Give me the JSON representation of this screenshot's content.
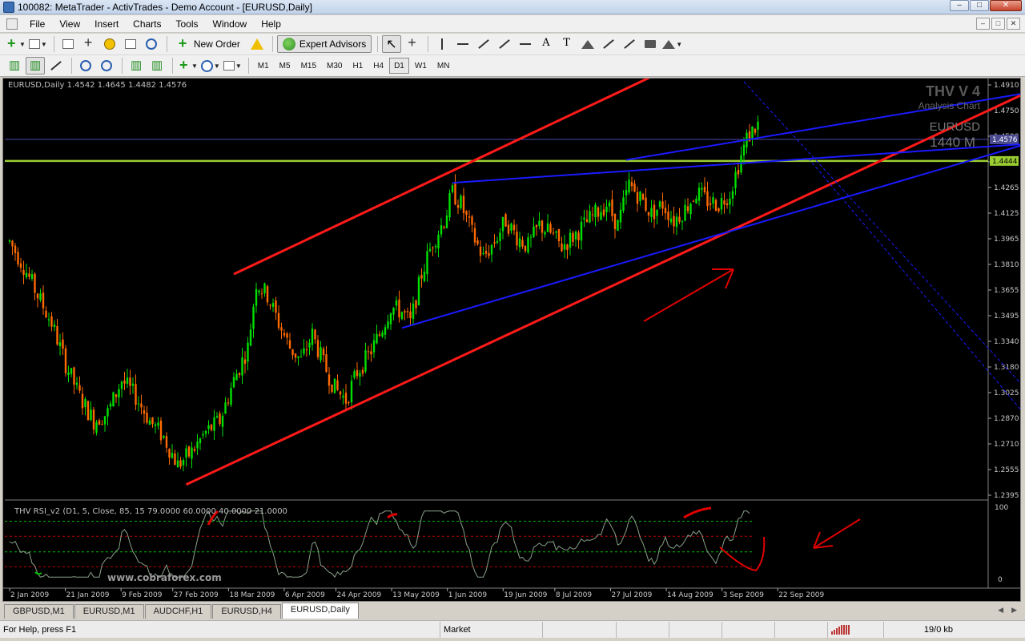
{
  "window": {
    "title": "100082: MetaTrader - ActivTrades - Demo Account - [EURUSD,Daily]",
    "controls": [
      "–",
      "□",
      "✕"
    ]
  },
  "menu": {
    "items": [
      "File",
      "View",
      "Insert",
      "Charts",
      "Tools",
      "Window",
      "Help"
    ]
  },
  "toolbar": {
    "new_order": "New Order",
    "expert_advisors": "Expert Advisors",
    "timeframes": [
      "M1",
      "M5",
      "M15",
      "M30",
      "H1",
      "H4",
      "D1",
      "W1",
      "MN"
    ],
    "active_timeframe": "D1"
  },
  "chart": {
    "header": "EURUSD,Daily  1.4542 1.4645 1.4482 1.4576",
    "indicator_header": "THV RSI_v2  (D1,  5,  Close,  85,  15 79.0000 60.0000 40.0000 21.0000",
    "overlay_title": "THV V 4",
    "overlay_subtitle": "Analysis Chart",
    "overlay_symbol": "EURUSD",
    "overlay_timeframe": "1440 M",
    "watermark": "www.cobraforex.com",
    "current_price_label": "1.4576",
    "level_price_label": "1.4444",
    "indicator_top_label": "100",
    "indicator_bottom_label": "0",
    "colors": {
      "background": "#000000",
      "bull_candle": "#00e000",
      "bear_candle": "#ff6a00",
      "channel": "#ff1a1a",
      "trendline": "#1a1aff",
      "level": "#9acd32",
      "annotation": "#e00000"
    }
  },
  "chart_data": {
    "type": "candlestick",
    "title": "",
    "symbol": "EURUSD",
    "timeframe": "Daily",
    "price_ticks": [
      "1.4910",
      "1.4750",
      "1.4590",
      "1.4428",
      "1.4265",
      "1.4125",
      "1.3965",
      "1.3810",
      "1.3655",
      "1.3495",
      "1.3340",
      "1.3180",
      "1.3025",
      "1.2870",
      "1.2710",
      "1.2555",
      "1.2395"
    ],
    "ylim": [
      1.2395,
      1.491
    ],
    "date_ticks": [
      "2 Jan 2009",
      "21 Jan 2009",
      "9 Feb 2009",
      "27 Feb 2009",
      "18 Mar 2009",
      "6 Apr 2009",
      "24 Apr 2009",
      "13 May 2009",
      "1 Jun 2009",
      "19 Jun 2009",
      "8 Jul 2009",
      "27 Jul 2009",
      "14 Aug 2009",
      "3 Sep 2009",
      "22 Sep 2009"
    ],
    "close_path": [
      [
        0,
        1.395
      ],
      [
        5,
        1.38
      ],
      [
        10,
        1.362
      ],
      [
        15,
        1.345
      ],
      [
        20,
        1.32
      ],
      [
        25,
        1.3
      ],
      [
        30,
        1.285
      ],
      [
        35,
        1.29
      ],
      [
        40,
        1.31
      ],
      [
        45,
        1.3
      ],
      [
        50,
        1.285
      ],
      [
        55,
        1.275
      ],
      [
        60,
        1.258
      ],
      [
        65,
        1.266
      ],
      [
        70,
        1.278
      ],
      [
        75,
        1.285
      ],
      [
        80,
        1.31
      ],
      [
        85,
        1.33
      ],
      [
        88,
        1.37
      ],
      [
        92,
        1.362
      ],
      [
        96,
        1.345
      ],
      [
        100,
        1.33
      ],
      [
        104,
        1.322
      ],
      [
        108,
        1.338
      ],
      [
        112,
        1.32
      ],
      [
        116,
        1.305
      ],
      [
        120,
        1.298
      ],
      [
        124,
        1.315
      ],
      [
        128,
        1.325
      ],
      [
        132,
        1.338
      ],
      [
        136,
        1.355
      ],
      [
        140,
        1.352
      ],
      [
        143,
        1.345
      ],
      [
        147,
        1.375
      ],
      [
        151,
        1.395
      ],
      [
        155,
        1.408
      ],
      [
        158,
        1.425
      ],
      [
        161,
        1.418
      ],
      [
        165,
        1.4
      ],
      [
        169,
        1.385
      ],
      [
        173,
        1.395
      ],
      [
        177,
        1.408
      ],
      [
        181,
        1.398
      ],
      [
        185,
        1.392
      ],
      [
        189,
        1.405
      ],
      [
        193,
        1.4
      ],
      [
        197,
        1.392
      ],
      [
        201,
        1.398
      ],
      [
        205,
        1.405
      ],
      [
        209,
        1.412
      ],
      [
        213,
        1.418
      ],
      [
        217,
        1.405
      ],
      [
        221,
        1.43
      ],
      [
        225,
        1.422
      ],
      [
        229,
        1.412
      ],
      [
        233,
        1.418
      ],
      [
        237,
        1.408
      ],
      [
        241,
        1.415
      ],
      [
        245,
        1.425
      ],
      [
        249,
        1.42
      ],
      [
        253,
        1.418
      ],
      [
        257,
        1.425
      ],
      [
        260,
        1.442
      ],
      [
        263,
        1.458
      ],
      [
        266,
        1.465
      ],
      [
        269,
        1.47
      ],
      [
        272,
        1.475
      ],
      [
        275,
        1.468
      ],
      [
        278,
        1.462
      ],
      [
        281,
        1.458
      ]
    ],
    "bars_count": 285,
    "horizontal_lines": [
      {
        "name": "current price",
        "y": 1.4576,
        "color": "#4a4ab0"
      },
      {
        "name": "level",
        "y": 1.4444,
        "color": "#9acd32"
      }
    ],
    "trendlines": [
      {
        "name": "channel upper",
        "color": "#ff1a1a",
        "from": [
          80,
          1.375
        ],
        "to": [
          240,
          1.505
        ]
      },
      {
        "name": "channel lower",
        "color": "#ff1a1a",
        "from": [
          63,
          1.246
        ],
        "to": [
          370,
          1.492
        ]
      },
      {
        "name": "upper trendline",
        "color": "#1a1aff",
        "from": [
          158,
          1.431
        ],
        "to": [
          373,
          1.456
        ]
      },
      {
        "name": "lower trendline",
        "color": "#1a1aff",
        "from": [
          140,
          1.342
        ],
        "to": [
          373,
          1.46
        ]
      },
      {
        "name": "fan upper",
        "color": "#1a1aff",
        "from": [
          220,
          1.445
        ],
        "to": [
          373,
          1.489
        ]
      },
      {
        "name": "dashed down 1",
        "color": "#1a1aff",
        "dashed": true,
        "from": [
          262,
          1.493
        ],
        "to": [
          373,
          1.285
        ]
      },
      {
        "name": "dashed down 2",
        "color": "#1a1aff",
        "dashed": true,
        "from": [
          285,
          1.446
        ],
        "to": [
          373,
          1.267
        ]
      }
    ],
    "indicator": {
      "name": "THV RSI_v2",
      "ylim": [
        0,
        100
      ],
      "levels": [
        79,
        60,
        40,
        21
      ]
    }
  },
  "tabs": {
    "items": [
      "GBPUSD,M1",
      "EURUSD,M1",
      "AUDCHF,H1",
      "EURUSD,H4",
      "EURUSD,Daily"
    ],
    "active_index": 4
  },
  "status": {
    "help": "For Help, press F1",
    "profile": "Market",
    "traffic": "19/0 kb"
  }
}
